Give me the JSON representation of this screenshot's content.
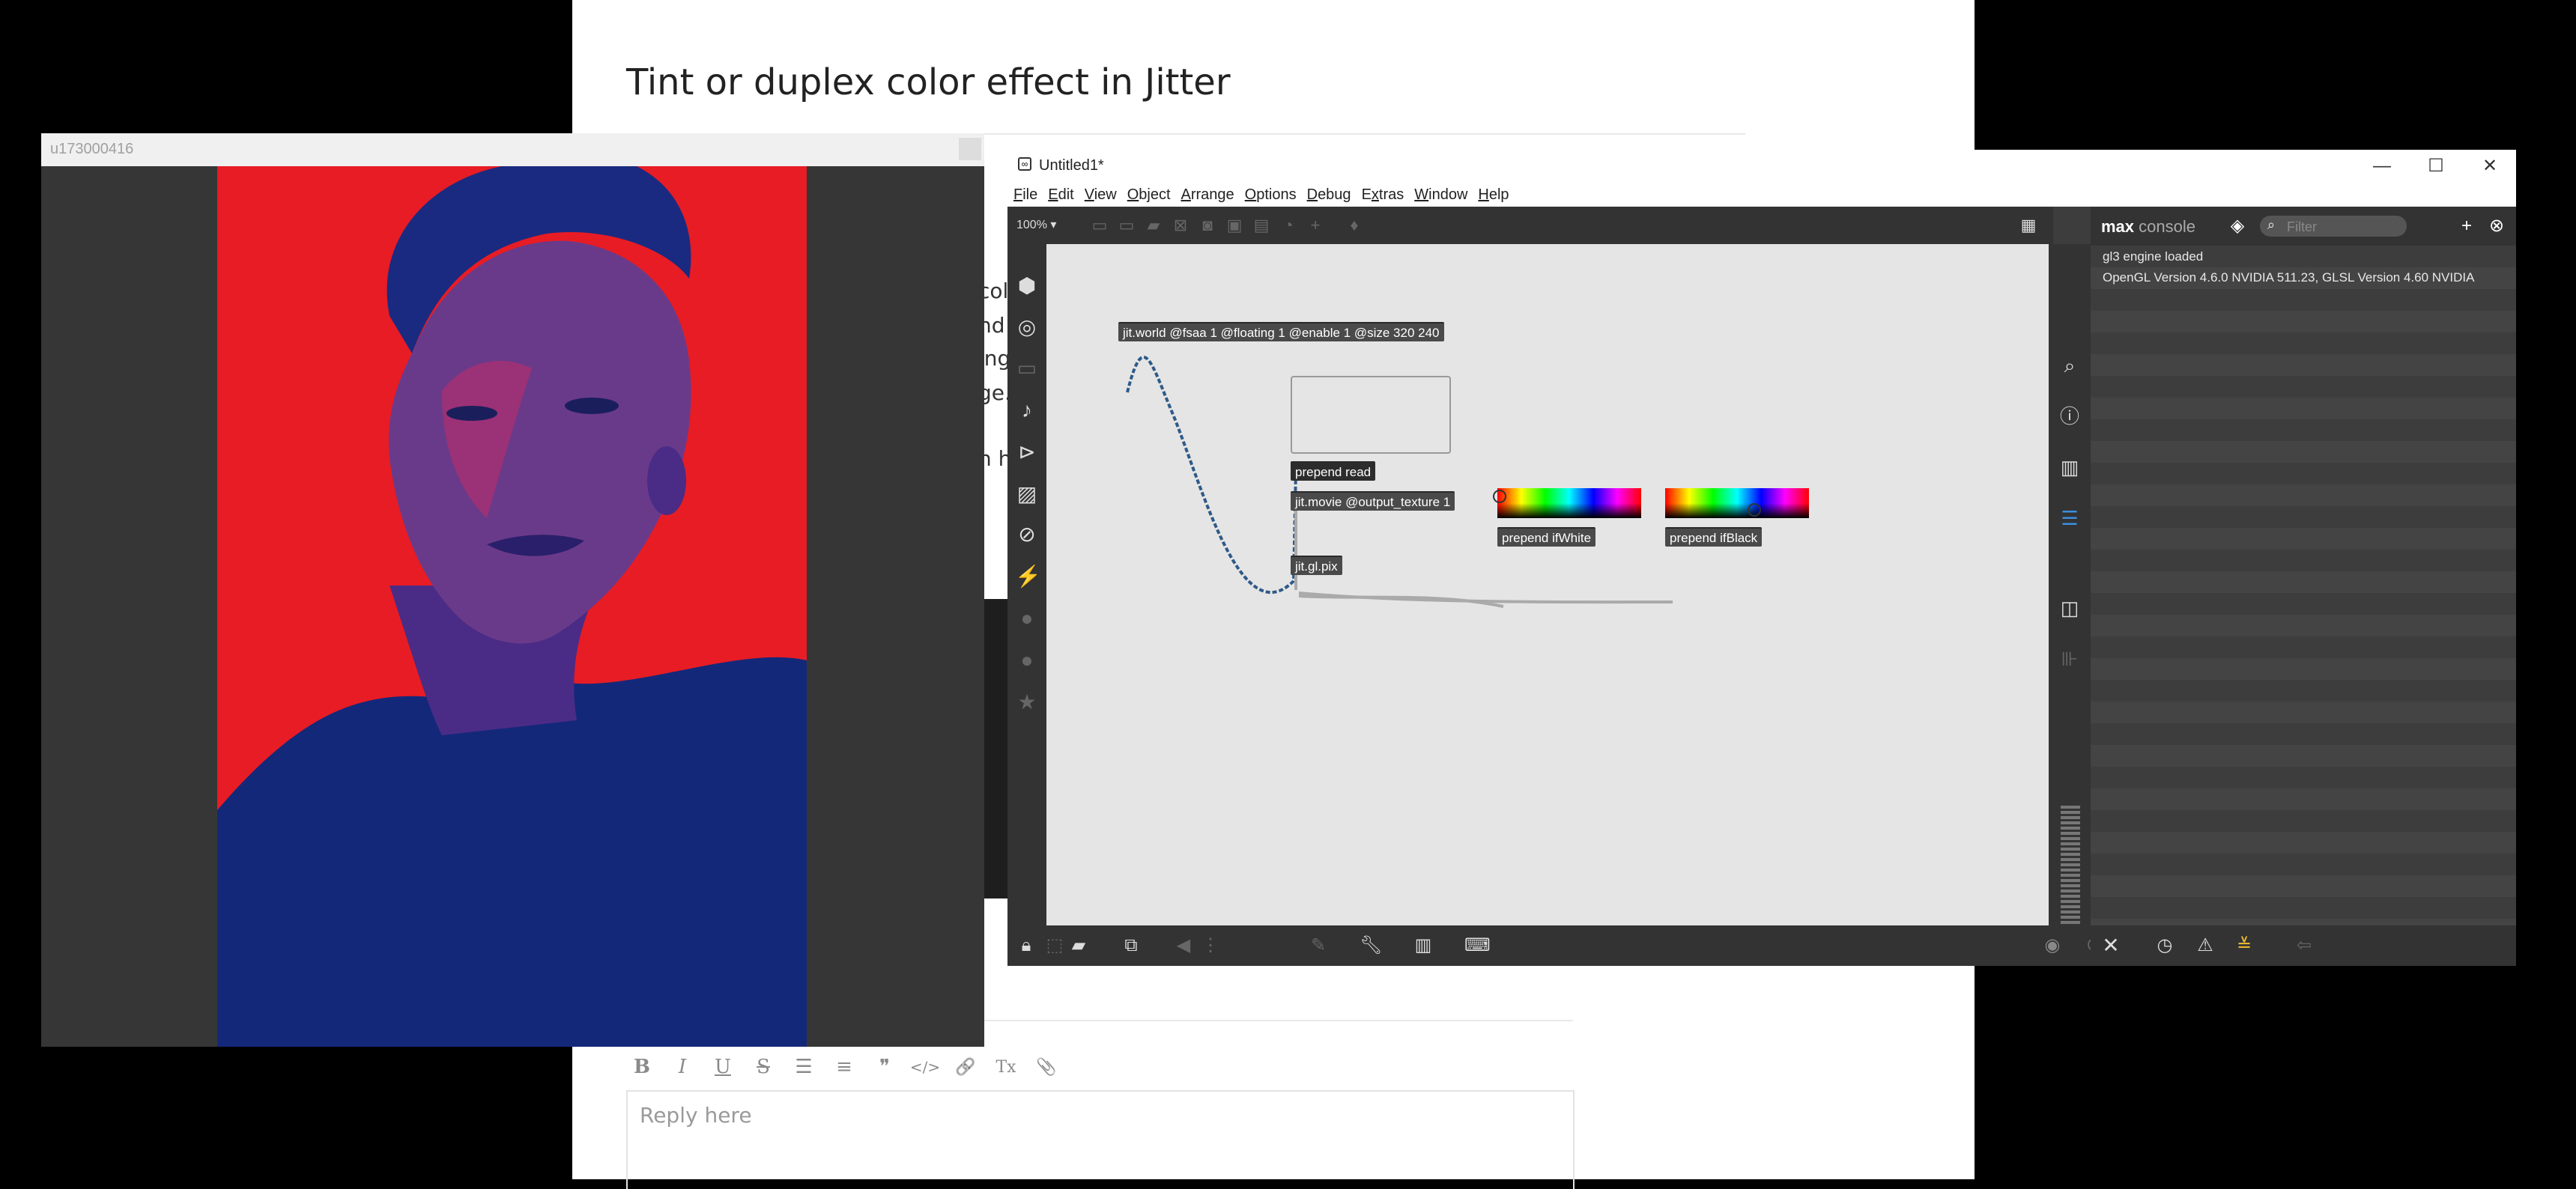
{
  "forum": {
    "title": "Tint or duplex color effect in Jitter",
    "fragments": [
      "colo",
      "nd t",
      "ing",
      "ge.",
      "h hi"
    ],
    "editor_toolbar": [
      {
        "name": "bold-icon",
        "glyph": "B"
      },
      {
        "name": "italic-icon",
        "glyph": "I"
      },
      {
        "name": "underline-icon",
        "glyph": "U"
      },
      {
        "name": "strikethrough-icon",
        "glyph": "S"
      },
      {
        "name": "bullet-list-icon",
        "glyph": "☰"
      },
      {
        "name": "numbered-list-icon",
        "glyph": "≡"
      },
      {
        "name": "quote-icon",
        "glyph": "❞"
      },
      {
        "name": "code-icon",
        "glyph": "</>"
      },
      {
        "name": "link-icon",
        "glyph": "🔗"
      },
      {
        "name": "clear-format-icon",
        "glyph": "Tx"
      },
      {
        "name": "attach-icon",
        "glyph": "📎"
      }
    ],
    "reply_placeholder": "Reply here"
  },
  "viewer": {
    "title": "u173000416",
    "image_colors": {
      "highlight": "#e81c24",
      "shadow": "#14287a"
    }
  },
  "max": {
    "window_title": "Untitled1*",
    "window_controls": [
      "—",
      "☐",
      "✕"
    ],
    "menus": [
      {
        "pre": "",
        "key": "F",
        "post": "ile"
      },
      {
        "pre": "",
        "key": "E",
        "post": "dit"
      },
      {
        "pre": "",
        "key": "V",
        "post": "iew"
      },
      {
        "pre": "",
        "key": "O",
        "post": "bject"
      },
      {
        "pre": "",
        "key": "A",
        "post": "rrange"
      },
      {
        "pre": "",
        "key": "O",
        "post": "ptions"
      },
      {
        "pre": "",
        "key": "D",
        "post": "ebug"
      },
      {
        "pre": "E",
        "key": "x",
        "post": "tras"
      },
      {
        "pre": "",
        "key": "W",
        "post": "indow"
      },
      {
        "pre": "",
        "key": "H",
        "post": "elp"
      }
    ],
    "zoom": "100% ▾",
    "objects": {
      "world": "jit.world @fsaa 1 @floating 1 @enable 1 @size 320 240",
      "prepend_read": "prepend read",
      "movie": "jit.movie @output_texture 1",
      "pix": "jit.gl.pix",
      "prepend_white": "prepend ifWhite",
      "prepend_black": "prepend ifBlack"
    },
    "console": {
      "brand_bold": "max",
      "brand_light": "console",
      "filter_placeholder": "Filter",
      "lines": [
        "gl3 engine loaded",
        "OpenGL Version 4.6.0 NVIDIA 511.23, GLSL Version 4.60 NVIDIA"
      ]
    }
  }
}
